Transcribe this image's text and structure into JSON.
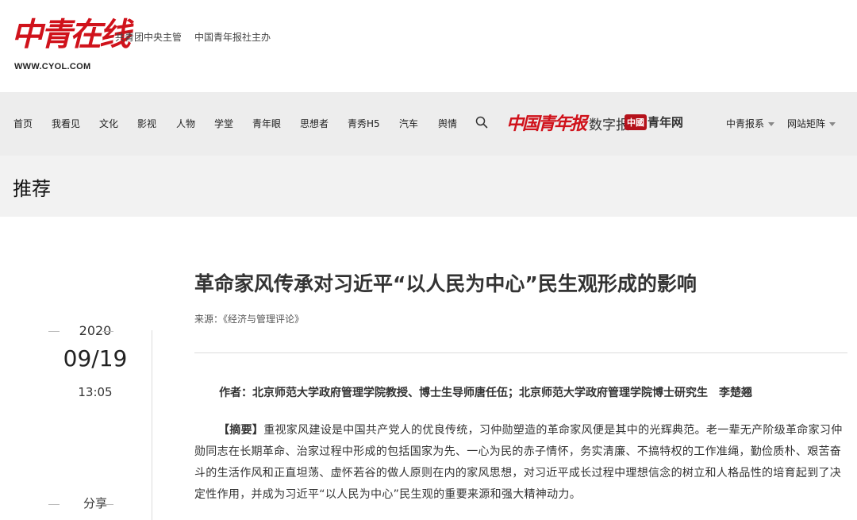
{
  "header": {
    "logo_text": "中青在线",
    "logo_url": "WWW.CYOL.COM",
    "sponsor_1": "共青团中央主管",
    "sponsor_2": "中国青年报社主办"
  },
  "nav": {
    "items": [
      "首页",
      "我看见",
      "文化",
      "影视",
      "人物",
      "学堂",
      "青年眼",
      "思想者",
      "青秀H5",
      "汽车",
      "舆情"
    ],
    "search_icon": "search-icon",
    "brand_paper_logo": "中国青年报",
    "brand_paper_sub": "数字报",
    "brand_net_badge": "中國",
    "brand_net_text": "青年网",
    "dropdown_1": "中青报系",
    "dropdown_2": "网站矩阵"
  },
  "section": {
    "title": "推荐"
  },
  "article": {
    "title": "革命家风传承对习近平“以人民为中心”民生观形成的影响",
    "source": "来源：《经济与管理评论》",
    "year": "2020",
    "monthday": "09/19",
    "time": "13:05",
    "share_label": "分享",
    "author": "作者：北京师范大学政府管理学院教授、博士生导师唐任伍；北京师范大学政府管理学院博士研究生　李楚翘",
    "abstract_label": "【摘要】",
    "abstract_text": "重视家风建设是中国共产党人的优良传统，习仲勋塑造的革命家风便是其中的光辉典范。老一辈无产阶级革命家习仲勋同志在长期革命、治家过程中形成的包括国家为先、一心为民的赤子情怀，务实清廉、不搞特权的工作准绳，勤俭质朴、艰苦奋斗的生活作风和正直坦荡、虚怀若谷的做人原则在内的家风思想，对习近平成长过程中理想信念的树立和人格品性的培育起到了决定性作用，并成为习近平“以人民为中心”民生观的重要来源和强大精神动力。"
  },
  "colors": {
    "brand_red": "#d0121b",
    "nav_bg": "#ededed",
    "section_bg": "#f2f2f2"
  }
}
